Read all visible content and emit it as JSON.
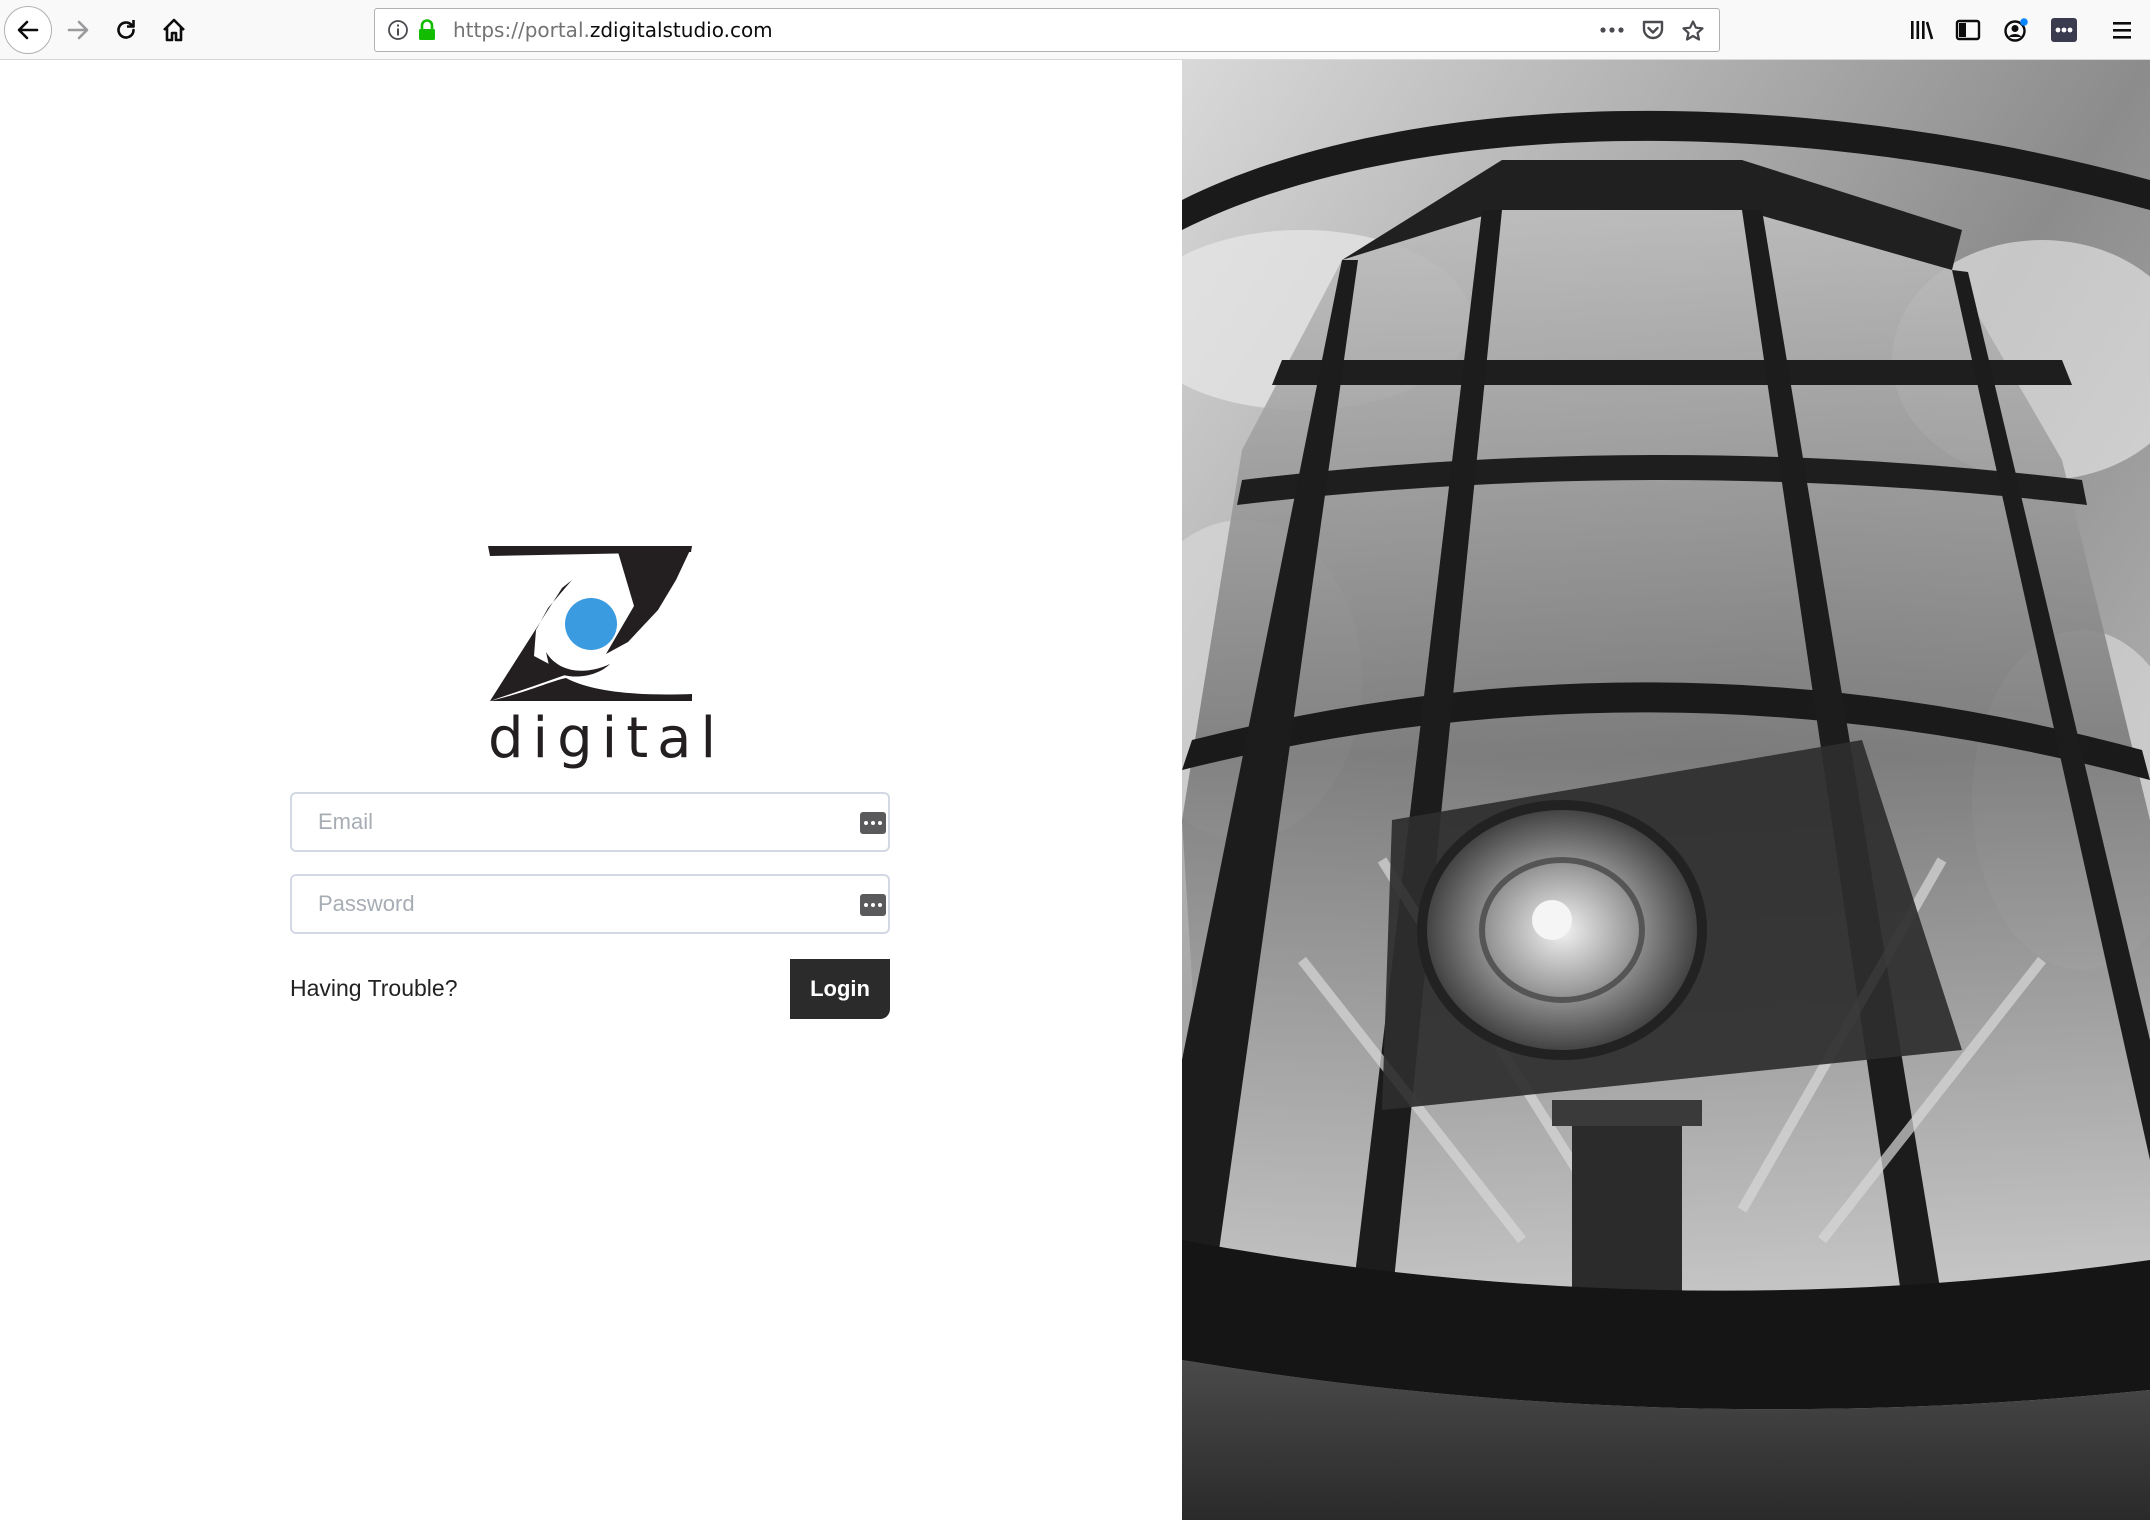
{
  "browser": {
    "url_prefix": "https://portal.",
    "url_domain": "zdigitalstudio.com",
    "icons": {
      "back": "back-arrow-icon",
      "forward": "forward-arrow-icon",
      "reload": "reload-icon",
      "home": "home-icon",
      "info": "info-icon",
      "lock": "lock-icon",
      "page_actions": "more-horizontal-icon",
      "pocket": "pocket-icon",
      "bookmark": "bookmark-star-icon",
      "library": "library-icon",
      "sidebar": "sidebar-icon",
      "account": "account-icon",
      "extension": "extension-icon",
      "menu": "hamburger-menu-icon"
    }
  },
  "login": {
    "logo_word": "digital",
    "email_placeholder": "Email",
    "password_placeholder": "Password",
    "trouble_label": "Having Trouble?",
    "login_label": "Login"
  },
  "colors": {
    "logo_dot": "#3b9be0",
    "logo_dark": "#231f20",
    "button_bg": "#2b2b2b",
    "secure_lock": "#12bc00"
  },
  "hero_image": {
    "description_icon": "lighthouse-lantern-photo"
  }
}
